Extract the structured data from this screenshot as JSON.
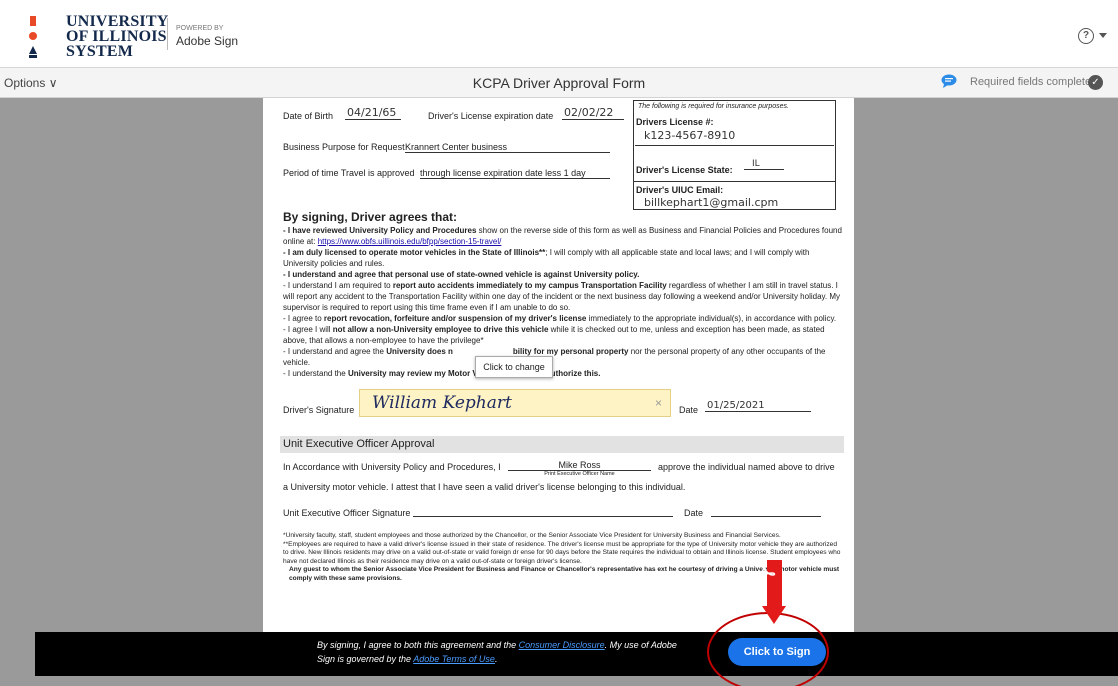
{
  "header": {
    "org_line1": "UNIVERSITY",
    "org_line2": "OF ILLINOIS",
    "org_line3": "SYSTEM",
    "powered_by": "POWERED BY",
    "product": "Adobe Sign",
    "help": "?"
  },
  "toolbar": {
    "options": "Options ∨",
    "title": "KCPA Driver Approval Form",
    "required_status": "Required fields completed",
    "check": "✓"
  },
  "form": {
    "dob_label": "Date of Birth",
    "dob_value": "04/21/65",
    "license_exp_label": "Driver's License expiration date",
    "license_exp_value": "02/02/22",
    "purpose_label": "Business Purpose for Request",
    "purpose_value": "Krannert Center business",
    "period_label": "Period of time Travel is approved",
    "period_value": "through license expiration date less 1 day",
    "insurance_note": "The following is required for insurance purposes.",
    "license_num_label": "Drivers License #:",
    "license_num_value": "k123-4567-8910",
    "license_state_label": "Driver's License State:",
    "license_state_value": "IL",
    "email_label": "Driver's UIUC Email:",
    "email_value": "billkephart1@gmail.cpm"
  },
  "terms": {
    "heading": "By signing, Driver agrees that:",
    "t1_bold": "- I have reviewed University Policy and Procedures",
    "t1_rest": " show on the reverse side of this form as well as Business and Financial Policies and Procedures found online at: ",
    "t1_link": "https://www.obfs.uillinois.edu/bfpp/section-15-travel/",
    "t2_bold": "- I am duly licensed to operate motor vehicles in the State of Illinois**",
    "t2_rest": "; I will comply with all applicable state and local laws; and I will comply with University policies and rules.",
    "t3_bold": "- I understand and agree that personal use of state-owned vehicle is against University policy.",
    "t4_pre": "- I understand I am required to ",
    "t4_bold": "report auto accidents immediately to my campus Transportation Facility",
    "t4_rest": " regardless of whether I am still in travel status.  I will report any accident to the Transportation Facility within one day of the incident or the next business day following a weekend and/or University holiday.  My supervisor is required to report using this time frame even if I am unable to do so.",
    "t5_pre": "- I agree to ",
    "t5_bold": "report revocation, forfeiture and/or suspension of my driver's license",
    "t5_rest": " immediately to the appropriate individual(s), in accordance with policy.",
    "t6_pre": "- I agree I will ",
    "t6_bold": "not allow a non-University employee to drive this vehicle",
    "t6_rest": " while it is checked out to me, unless and exception has been made, as stated above, that allows a non-employee to have the privilege*",
    "t7_pre": "- I understand and agree the ",
    "t7_bold": "University does n",
    "t7_mid": "                           ",
    "t7_bold2": "bility for my personal property",
    "t7_rest": " nor the personal property of any other occupants of the vehicle.",
    "t8_pre": "- I understand the ",
    "t8_bold": "University may review my Motor Ve    cle Report and I authorize this."
  },
  "tooltip": "Click to change",
  "signature": {
    "label": "Driver's Signature",
    "value": "William Kephart",
    "clear": "×",
    "date_label": "Date",
    "date_value": "01/25/2021"
  },
  "approval": {
    "heading": "Unit Executive Officer Approval",
    "line1_pre": "In Accordance with University Policy and Procedures, I",
    "officer_name": "Mike Ross",
    "officer_caption": "Print Executive Officer Name",
    "line1_post": "approve the individual named above to drive",
    "line2": "a University motor vehicle.  I attest that I have seen a valid driver's license belonging to this individual.",
    "sig_label": "Unit Executive Officer Signature",
    "date_label": "Date"
  },
  "footnotes": {
    "f1": "*University faculty, staff, student employees and those authorized by the Chancellor, or the Senior Associate Vice President for University Business and Financial Services.",
    "f2": "**Employees are required to have a valid driver's license issued in their state of residence. The driver's license must be appropriate for the type of University motor vehicle they are authorized to drive.  New Illinois residents may drive on a valid out-of-state or valid foreign dr      ense for 90 days before the State requires the individual to obtain and Illinois license.  Student employees who have not declared Illinois as their      residence may drive on a valid out-of-state or foreign driver's license.",
    "f3": "Any guest to whom the Senior Associate Vice President for Business and Finance or Chancellor's representative has ext      he courtesy of driving a University motor vehicle must comply with these same provisions."
  },
  "bottom": {
    "consent_pre": "By signing, I agree to both this agreement and the ",
    "consent_link1": "Consumer Disclosure",
    "consent_mid": ". My use of Adobe Sign is governed by the ",
    "consent_link2": "Adobe Terms of Use",
    "consent_post": ".",
    "sign_button": "Click to Sign",
    "arrow_label": "Sign"
  },
  "colors": {
    "accent": "#1a73e8",
    "annotation_red": "#c00000",
    "signature_field": "#fdf3c4"
  }
}
